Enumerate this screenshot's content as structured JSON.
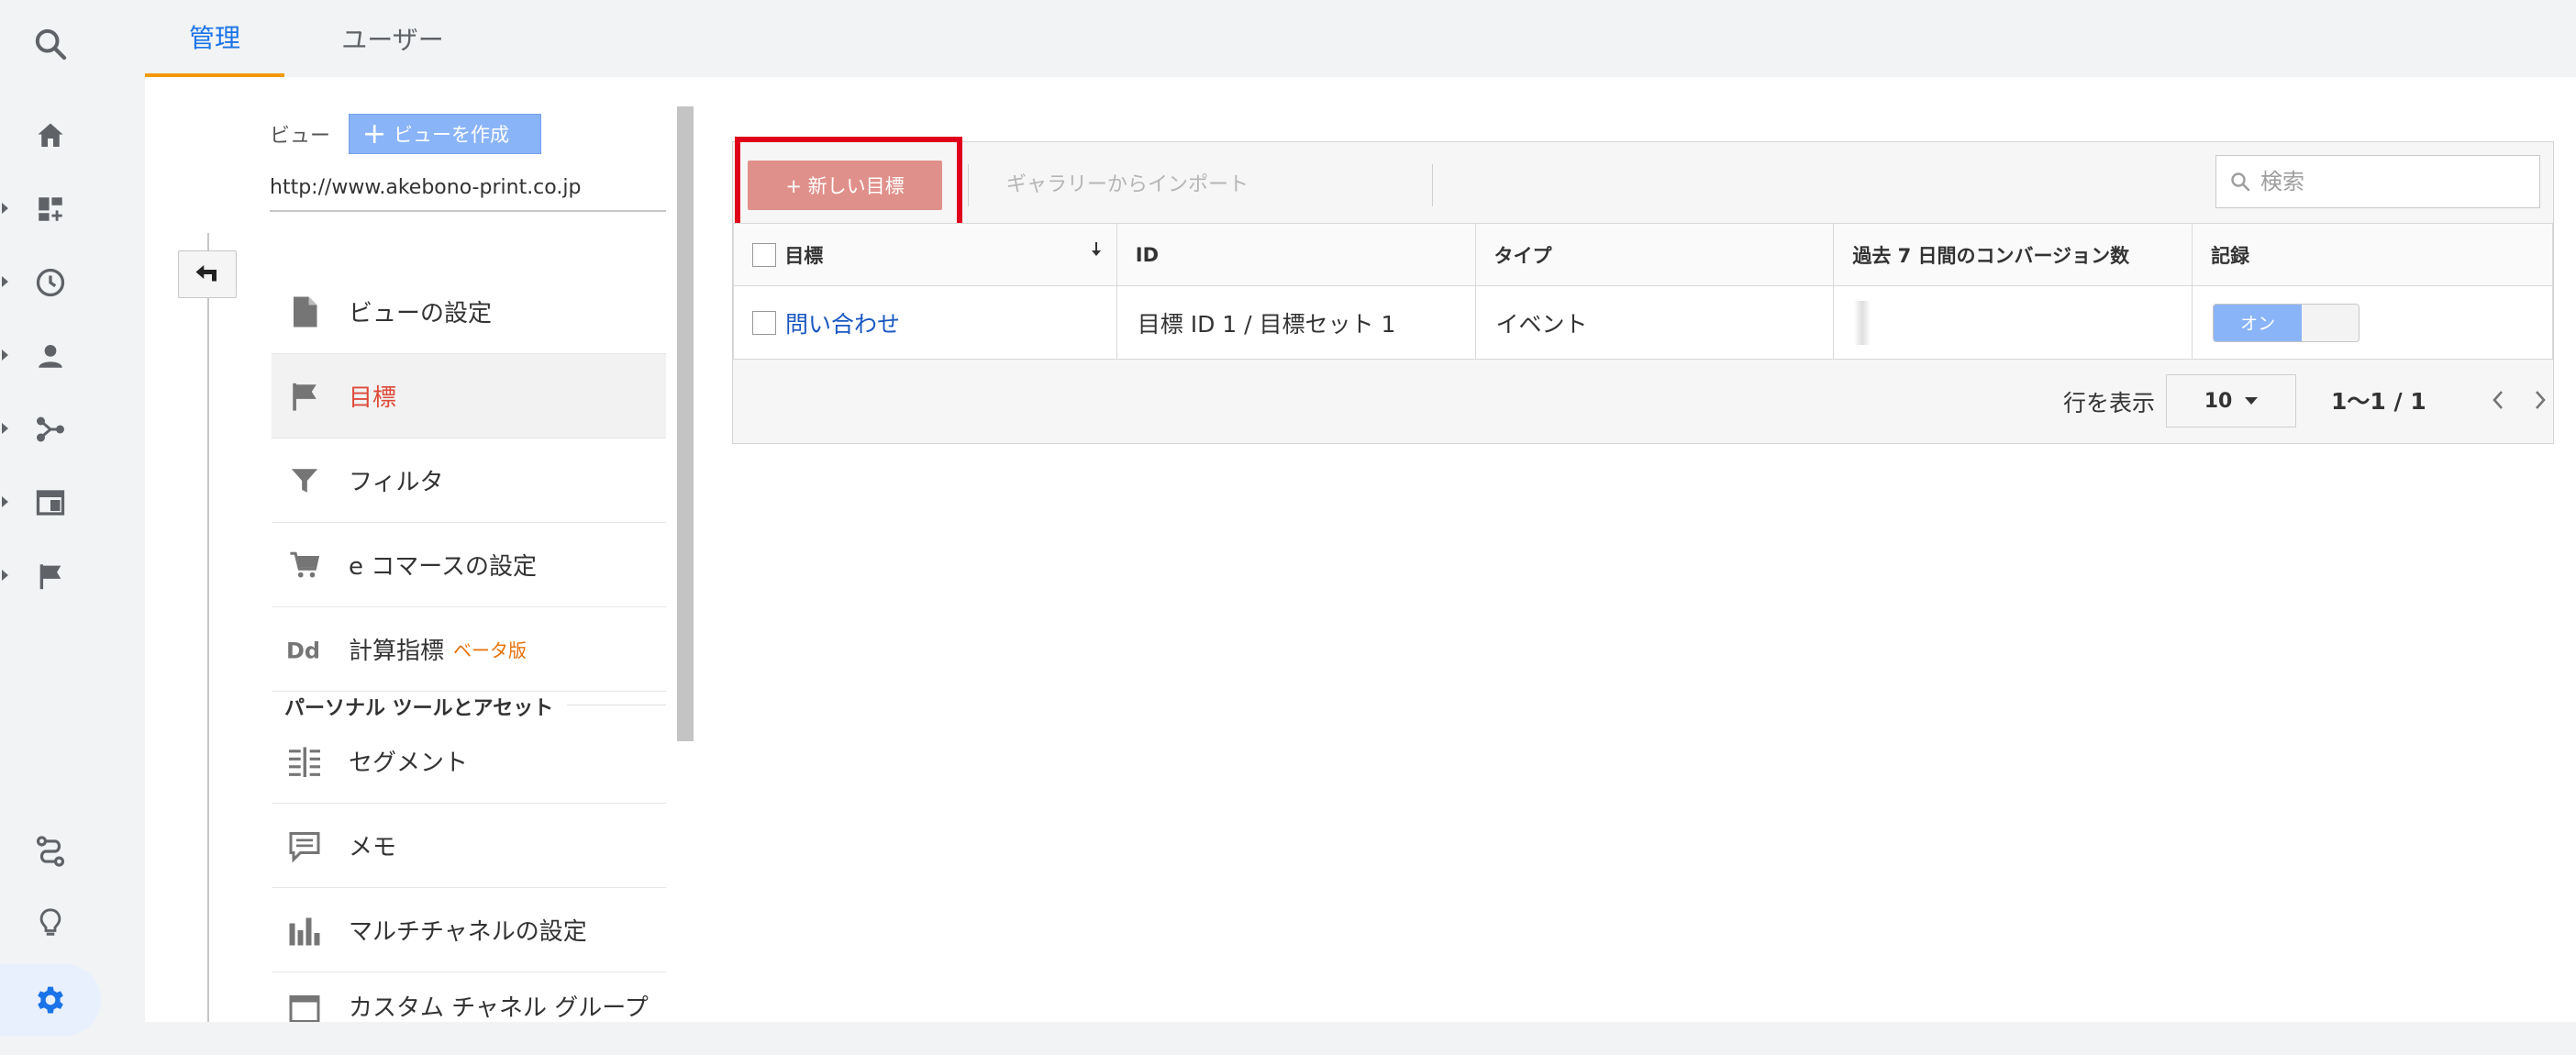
{
  "tabs": [
    {
      "label": "管理",
      "active": true
    },
    {
      "label": "ユーザー",
      "active": false
    }
  ],
  "rail": {
    "icons": [
      "search-icon",
      "home-icon",
      "dashboard-icon",
      "clock-icon",
      "person-icon",
      "acquisition-icon",
      "behavior-icon",
      "flag-icon",
      "route-icon",
      "lightbulb-icon",
      "gear-icon"
    ]
  },
  "view": {
    "label": "ビュー",
    "create_button": "ビューを作成",
    "url": "http://www.akebono-print.co.jp"
  },
  "nav": {
    "items": [
      {
        "label": "ビューの設定",
        "icon": "document-icon"
      },
      {
        "label": "目標",
        "icon": "flag-icon",
        "active": true
      },
      {
        "label": "フィルタ",
        "icon": "filter-icon"
      },
      {
        "label": "e コマースの設定",
        "icon": "cart-icon"
      },
      {
        "label": "計算指標",
        "icon": "dd-icon",
        "badge": "ベータ版"
      }
    ],
    "section_heading": "パーソナル ツールとアセット",
    "personal_items": [
      {
        "label": "セグメント",
        "icon": "segment-icon"
      },
      {
        "label": "メモ",
        "icon": "comment-icon"
      },
      {
        "label": "マルチチャネルの設定",
        "icon": "bar-chart-icon"
      },
      {
        "label": "カスタム チャネル グループ",
        "icon": "channel-group-icon"
      }
    ]
  },
  "toolbar": {
    "new_goal": "+ 新しい目標",
    "import": "ギャラリーからインポート",
    "search_placeholder": "検索"
  },
  "table": {
    "headers": [
      "目標",
      "ID",
      "タイプ",
      "過去 7 日間のコンバージョン数",
      "記録"
    ],
    "rows": [
      {
        "goal": "問い合わせ",
        "id": "目標 ID 1 / 目標セット 1",
        "type": "イベント",
        "conversions": "",
        "recording": "オン"
      }
    ]
  },
  "pager": {
    "rows_label": "行を表示",
    "rows_value": "10",
    "range": "1〜1 / 1"
  },
  "colors": {
    "accent": "#1a73e8",
    "tab_underline": "#f29900",
    "active_nav": "#dd4b39",
    "new_goal_button": "#e0908a",
    "highlight": "#e0001b",
    "toggle_on": "#8ab4f8"
  }
}
